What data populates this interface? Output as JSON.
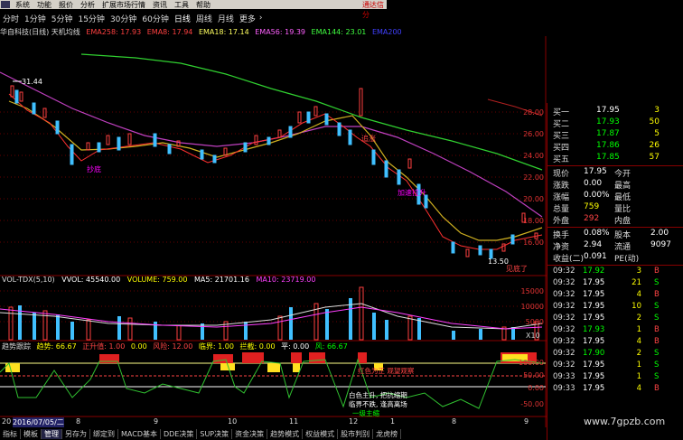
{
  "menu": {
    "items": [
      "系统",
      "功能",
      "报价",
      "分析",
      "扩展市场行情",
      "资讯",
      "工具",
      "帮助"
    ],
    "right_text": "通达信分"
  },
  "periods": {
    "items": [
      "分时",
      "1分钟",
      "5分钟",
      "15分钟",
      "30分钟",
      "60分钟",
      "日线",
      "周线",
      "月线",
      "更多"
    ],
    "active": "日线",
    "arrow": "›"
  },
  "ma_legend": {
    "title": "华自科技(日线) 天机均线",
    "items": [
      {
        "text": "EMA258: 17.93",
        "color": "#ff4040"
      },
      {
        "text": "EMA8: 17.94",
        "color": "#ff4040"
      },
      {
        "text": "EMA18: 17.14",
        "color": "#ffff60"
      },
      {
        "text": "EMA56: 19.39",
        "color": "#ff60ff"
      },
      {
        "text": "EMA144: 23.01",
        "color": "#40ff40"
      },
      {
        "text": "EMA200",
        "color": "#4040ff"
      }
    ]
  },
  "price_chart": {
    "y_ticks": [
      "28.00",
      "26.00",
      "24.00",
      "22.00",
      "20.00",
      "18.00",
      "16.00"
    ],
    "annotations": {
      "high_label": "31.44",
      "buy_label": "抄底",
      "mid_label": "追涨",
      "rise_label": "加速拉升",
      "box_label": "见底了",
      "bottom_label": "13.50"
    }
  },
  "volume_chart": {
    "legend": [
      {
        "text": "VOL-TDX(5,10)",
        "color": "#ddd"
      },
      {
        "text": "VVOL: 45540.00",
        "color": "#fff"
      },
      {
        "text": "VOLUME: 759.00",
        "color": "#ff0"
      },
      {
        "text": "MA5: 21701.16",
        "color": "#fff"
      },
      {
        "text": "MA10: 23719.00",
        "color": "#ff40ff"
      }
    ],
    "y_ticks": [
      "15000",
      "10000",
      "5000"
    ],
    "unit": "X10"
  },
  "indicator": {
    "legend": [
      {
        "text": "趋势跟踪",
        "color": "#ddd"
      },
      {
        "text": "趋势: 66.67",
        "color": "#ff0"
      },
      {
        "text": "正升值: 1.00",
        "color": "#f44"
      },
      {
        "text": "0.00",
        "color": "#ff0"
      },
      {
        "text": "风险: 12.00",
        "color": "#f44"
      },
      {
        "text": "临界: 1.00",
        "color": "#ff0"
      },
      {
        "text": "拦截: 0.00",
        "color": "#ff0"
      },
      {
        "text": "平: 0.00",
        "color": "#fff"
      },
      {
        "text": "风: 66.67",
        "color": "#0f0"
      }
    ],
    "y_ticks": [
      "100.00",
      "50.00",
      "0.00",
      "-50.00"
    ],
    "notes": [
      "红色为正 观望观察",
      "白色主升, 把抗缩期",
      "临界不跌, 逢高离场",
      "一级主缩"
    ]
  },
  "quote": {
    "asks": [
      {
        "label": "买一",
        "price": "17.95",
        "vol": "3"
      },
      {
        "label": "买二",
        "price": "17.93",
        "vol": "50"
      },
      {
        "label": "买三",
        "price": "17.87",
        "vol": "5"
      },
      {
        "label": "买四",
        "price": "17.86",
        "vol": "26"
      },
      {
        "label": "买五",
        "price": "17.85",
        "vol": "57"
      }
    ],
    "stats": [
      {
        "l1": "现价",
        "v1": "17.95",
        "l2": "今开",
        "v2": ""
      },
      {
        "l1": "涨跌",
        "v1": "0.00",
        "l2": "最高",
        "v2": ""
      },
      {
        "l1": "涨幅",
        "v1": "0.00%",
        "l2": "最低",
        "v2": ""
      },
      {
        "l1": "总量",
        "v1": "759",
        "l2": "量比",
        "v2": ""
      },
      {
        "l1": "外盘",
        "v1": "292",
        "l2": "内盘",
        "v2": ""
      },
      {
        "l1": "换手",
        "v1": "0.08%",
        "l2": "股本",
        "v2": "2.00"
      },
      {
        "l1": "净资",
        "v1": "2.94",
        "l2": "流通",
        "v2": "9097"
      },
      {
        "l1": "收益(二)",
        "v1": "0.091",
        "l2": "PE(动)",
        "v2": ""
      }
    ],
    "ticks": [
      {
        "time": "09:32",
        "price": "17.92",
        "qty": "3",
        "dir": "B"
      },
      {
        "time": "09:32",
        "price": "17.95",
        "qty": "21",
        "dir": "S"
      },
      {
        "time": "09:32",
        "price": "17.95",
        "qty": "4",
        "dir": "B"
      },
      {
        "time": "09:32",
        "price": "17.95",
        "qty": "10",
        "dir": "S"
      },
      {
        "time": "09:32",
        "price": "17.95",
        "qty": "2",
        "dir": "S"
      },
      {
        "time": "09:32",
        "price": "17.93",
        "qty": "1",
        "dir": "B"
      },
      {
        "time": "09:32",
        "price": "17.95",
        "qty": "4",
        "dir": "B"
      },
      {
        "time": "09:32",
        "price": "17.90",
        "qty": "2",
        "dir": "S"
      },
      {
        "time": "09:32",
        "price": "17.95",
        "qty": "1",
        "dir": "S"
      },
      {
        "time": "09:33",
        "price": "17.95",
        "qty": "1",
        "dir": "S"
      },
      {
        "time": "09:33",
        "price": "17.95",
        "qty": "4",
        "dir": "B"
      }
    ]
  },
  "dates": {
    "first": "2016/07/05/二",
    "labels": [
      "20",
      "8",
      "9",
      "10",
      "11",
      "12",
      "1",
      "8",
      "9"
    ]
  },
  "bottom_tabs": [
    "指标",
    "模板",
    "管理",
    "另存为",
    "绑定到",
    "MACD基本",
    "DDE决策",
    "SUP决策",
    "资金决策",
    "趋势模式",
    "权益模式",
    "股市判别",
    "龙虎榜"
  ],
  "bottom_active": "管理",
  "watermark": "www.7gpzb.com"
}
